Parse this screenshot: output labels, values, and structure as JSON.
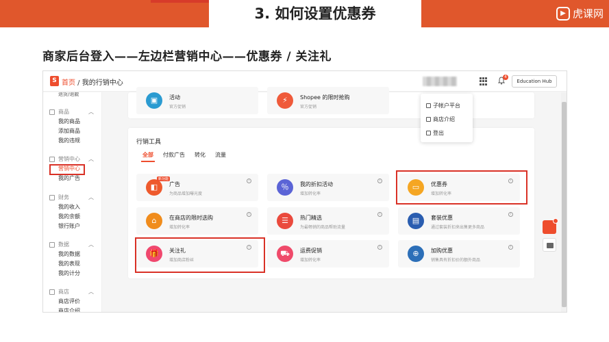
{
  "slide": {
    "title": "3. 如何设置优惠券",
    "brand": "虎课网",
    "subtitle": "商家后台登入——左边栏营销中心——优惠券 /   关注礼"
  },
  "app": {
    "breadcrumb_home": "首页",
    "breadcrumb_sep": " / ",
    "breadcrumb_current": "我的行销中心",
    "edu_hub": "Education Hub",
    "notification_count": "4",
    "user_menu": [
      {
        "label": "子帐户平台",
        "icon": "user-icon"
      },
      {
        "label": "商店介绍",
        "icon": "shop-icon"
      },
      {
        "label": "登出",
        "icon": "logout-icon"
      }
    ]
  },
  "sidebar": {
    "top_fragment": "退货/退款",
    "groups": [
      {
        "title": "商品",
        "items": [
          "我的商品",
          "添加商品",
          "我的违规"
        ]
      },
      {
        "title": "营销中心",
        "items": [
          "营销中心",
          "我的广告"
        ]
      },
      {
        "title": "财务",
        "items": [
          "我的收入",
          "我的余额",
          "银行账户"
        ]
      },
      {
        "title": "数据",
        "items": [
          "我的数据",
          "我的表现",
          "我的计分"
        ]
      },
      {
        "title": "商店",
        "items": [
          "商店评价",
          "商店介绍"
        ]
      }
    ]
  },
  "top_tiles": [
    {
      "name": "活动",
      "desc": "官方促销",
      "color": "#2b9bd1"
    },
    {
      "name": "Shopee 的限时抢购",
      "desc": "官方促销",
      "color": "#ef5a3a"
    }
  ],
  "tools": {
    "title": "行销工具",
    "tabs": [
      "全部",
      "付款广告",
      "转化",
      "流量"
    ],
    "items": [
      {
        "name": "广告",
        "desc": "为商品增加曝光度",
        "color": "#ee5a2d",
        "badge": "新功能"
      },
      {
        "name": "我的折扣活动",
        "desc": "增加转化率",
        "color": "#5b64d6"
      },
      {
        "name": "优惠券",
        "desc": "增加转化率",
        "color": "#f5a623"
      },
      {
        "name": "在商店的限时选购",
        "desc": "增加转化率",
        "color": "#f08c1c"
      },
      {
        "name": "热门精选",
        "desc": "为最畅销的商品帮助流量",
        "color": "#ea4a3d"
      },
      {
        "name": "套装优惠",
        "desc": "通过套装折扣来出售更多商品",
        "color": "#2a5db0"
      },
      {
        "name": "关注礼",
        "desc": "增加商店粉丝",
        "color": "#f0486e"
      },
      {
        "name": "运费促销",
        "desc": "增加转化率",
        "color": "#ef4a6a"
      },
      {
        "name": "加购优惠",
        "desc": "销售具有折扣价的额外商品",
        "color": "#2c6fb8"
      }
    ]
  }
}
